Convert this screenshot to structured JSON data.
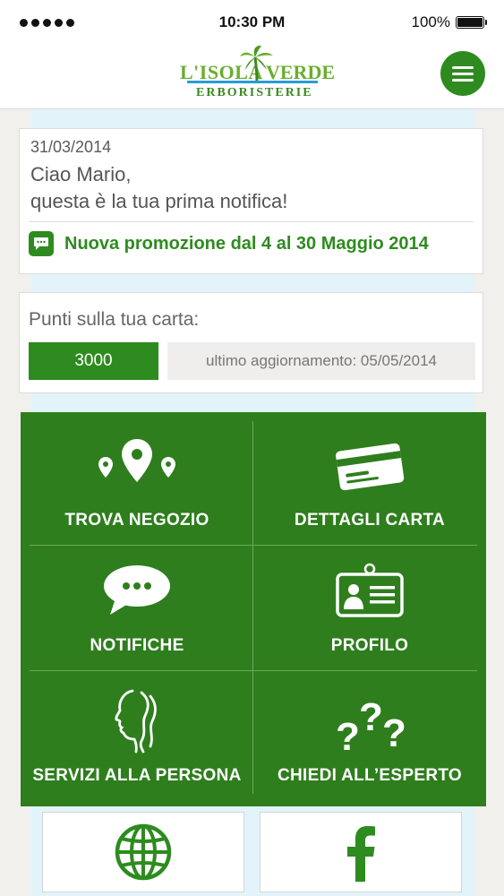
{
  "status_bar": {
    "time": "10:30 PM",
    "battery": "100%",
    "signal_icon": "signal-dots-icon",
    "battery_icon": "battery-icon"
  },
  "header": {
    "logo_text_left": "L'ISOLA",
    "logo_text_right": "VERDE",
    "logo_subtitle": "ERBORISTERIE",
    "menu_icon": "hamburger-menu-icon"
  },
  "notification": {
    "date": "31/03/2014",
    "greeting": "Ciao Mario,",
    "message": "questa è la tua prima notifica!",
    "promo_icon": "chat-bubble-icon",
    "promo_text": "Nuova promozione dal 4 al 30 Maggio 2014"
  },
  "points": {
    "title": "Punti sulla tua carta:",
    "value": "3000",
    "last_update": "ultimo aggiornamento: 05/05/2014"
  },
  "menu_grid": [
    {
      "label": "TROVA NEGOZIO",
      "icon": "map-pin-icon"
    },
    {
      "label": "DETTAGLI CARTA",
      "icon": "credit-card-icon"
    },
    {
      "label": "NOTIFICHE",
      "icon": "speech-bubble-icon"
    },
    {
      "label": "PROFILO",
      "icon": "id-badge-icon"
    },
    {
      "label": "SERVIZI ALLA PERSONA",
      "icon": "face-profile-icon"
    },
    {
      "label": "CHIEDI ALL’ESPERTO",
      "icon": "question-marks-icon"
    }
  ],
  "bottom_links": [
    {
      "icon": "globe-icon"
    },
    {
      "icon": "facebook-icon"
    }
  ],
  "colors": {
    "brand_green": "#2e8b1f",
    "grid_green": "#2e7e1d",
    "logo_green": "#6aae2e",
    "accent_blue": "#2a9bd6",
    "background_light_blue": "#e3f3fa"
  }
}
